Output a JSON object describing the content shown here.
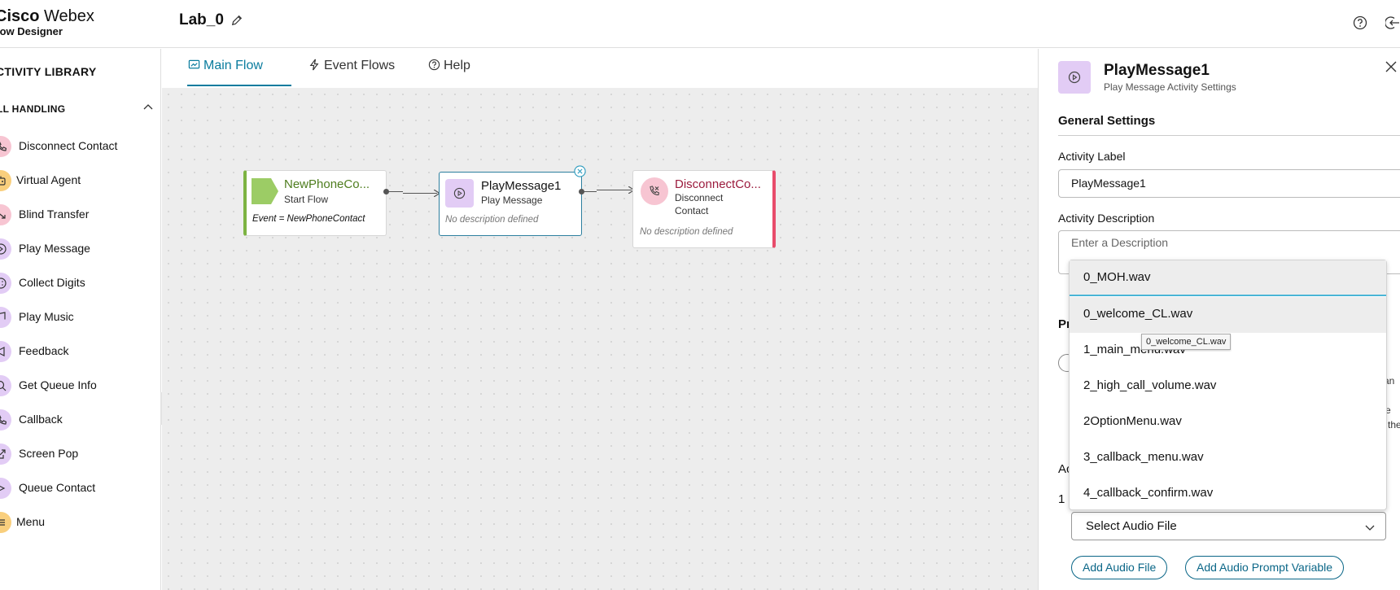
{
  "header": {
    "brand_line1_bold": "Cisco",
    "brand_line1_rest": " Webex",
    "brand_line2": "low Designer",
    "flow_name": "Lab_0"
  },
  "sidebar": {
    "title": "CTIVITY LIBRARY",
    "category": "LL HANDLING",
    "items": [
      {
        "label": "Disconnect Contact",
        "icon": "disconnect-icon",
        "color": "#f7c5d2"
      },
      {
        "label": "Virtual Agent",
        "icon": "bot-icon",
        "color": "#f9cf7d"
      },
      {
        "label": "Blind Transfer",
        "icon": "transfer-icon",
        "color": "#f7c5d2"
      },
      {
        "label": "Play Message",
        "icon": "play-icon",
        "color": "#e2ccf5"
      },
      {
        "label": "Collect Digits",
        "icon": "digits-icon",
        "color": "#e2ccf5"
      },
      {
        "label": "Play Music",
        "icon": "music-icon",
        "color": "#e2ccf5"
      },
      {
        "label": "Feedback",
        "icon": "megaphone-icon",
        "color": "#e2ccf5"
      },
      {
        "label": "Get Queue Info",
        "icon": "search-icon",
        "color": "#e2ccf5"
      },
      {
        "label": "Callback",
        "icon": "callback-icon",
        "color": "#e2ccf5"
      },
      {
        "label": "Screen Pop",
        "icon": "popout-icon",
        "color": "#e2ccf5"
      },
      {
        "label": "Queue Contact",
        "icon": "queue-icon",
        "color": "#e2ccf5"
      },
      {
        "label": "Menu",
        "icon": "menu-icon",
        "color": "#f9cf7d"
      }
    ]
  },
  "tabs": [
    {
      "label": "Main Flow"
    },
    {
      "label": "Event Flows"
    },
    {
      "label": "Help"
    }
  ],
  "canvas": {
    "start_node": {
      "title": "NewPhoneCo...",
      "subtitle": "Start Flow",
      "event": "Event = NewPhoneContact"
    },
    "play_node": {
      "title": "PlayMessage1",
      "subtitle": "Play Message",
      "desc": "No description defined"
    },
    "disconnect_node": {
      "title": "DisconnectCo...",
      "subtitle_line1": "Disconnect",
      "subtitle_line2": "Contact",
      "desc": "No description defined"
    }
  },
  "panel": {
    "title": "PlayMessage1",
    "subtitle": "Play Message Activity Settings",
    "section": "General Settings",
    "activity_label_caption": "Activity Label",
    "activity_label_value": "PlayMessage1",
    "activity_desc_caption": "Activity Description",
    "activity_desc_placeholder": "Enter a Description",
    "partial_heading1": "Pr",
    "partial_heading2": "Ac",
    "partial_row": "1",
    "clipped1": "an",
    "clipped2": "e",
    "clipped3": "the",
    "select_value": "Select Audio File",
    "add_audio_button": "Add Audio File",
    "add_prompt_button": "Add Audio Prompt Variable"
  },
  "dropdown": {
    "options": [
      "0_MOH.wav",
      "0_welcome_CL.wav",
      "1_main_menu.wav",
      "2_high_call_volume.wav",
      "2OptionMenu.wav",
      "3_callback_menu.wav",
      "4_callback_confirm.wav"
    ],
    "tooltip": "0_welcome_CL.wav"
  },
  "colors": {
    "accent": "#0a7c9e",
    "start_green": "#8bc34a",
    "disconnect_red": "#e84c6b",
    "play_purple": "#e2ccf5"
  }
}
